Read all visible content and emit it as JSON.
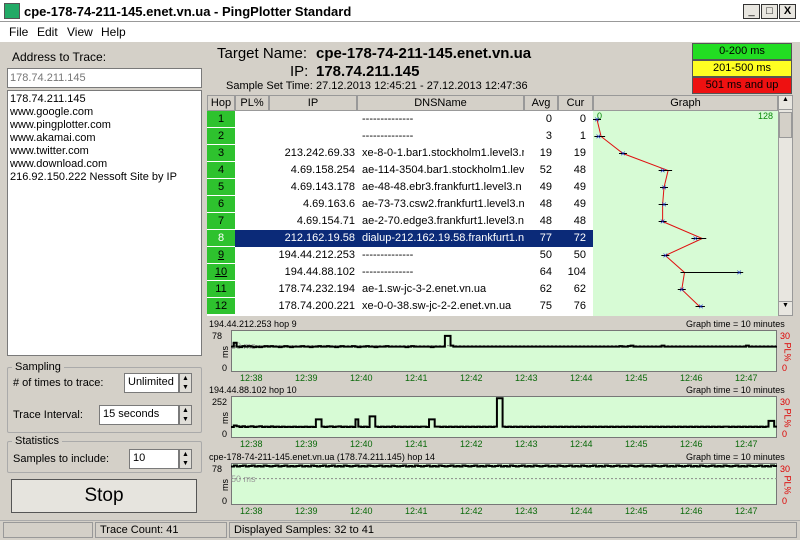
{
  "window": {
    "title": "cpe-178-74-211-145.enet.vn.ua - PingPlotter Standard",
    "min_label": "_",
    "max_label": "□",
    "close_label": "X"
  },
  "menu": [
    "File",
    "Edit",
    "View",
    "Help"
  ],
  "left": {
    "address_label": "Address to Trace:",
    "address_value": "178.74.211.145",
    "history": [
      "178.74.211.145",
      "www.google.com",
      "www.pingplotter.com",
      "www.akamai.com",
      "www.twitter.com",
      "www.download.com",
      "216.92.150.222 Nessoft Site by IP"
    ],
    "sampling_title": "Sampling",
    "times_label": "# of times to trace:",
    "times_value": "Unlimited",
    "interval_label": "Trace Interval:",
    "interval_value": "15 seconds",
    "stats_title": "Statistics",
    "samples_label": "Samples to include:",
    "samples_value": "10",
    "stop_label": "Stop"
  },
  "target": {
    "name_label": "Target Name:",
    "name_value": "cpe-178-74-211-145.enet.vn.ua",
    "ip_label": "IP:",
    "ip_value": "178.74.211.145",
    "time_label": "Sample Set Time:",
    "time_value": "27.12.2013 12:45:21 - 27.12.2013 12:47:36"
  },
  "legend": [
    {
      "label": "0-200 ms",
      "color": "#22dd22"
    },
    {
      "label": "201-500 ms",
      "color": "#ffff22"
    },
    {
      "label": "501 ms and up",
      "color": "#ee1111"
    }
  ],
  "columns": {
    "hop": "Hop",
    "pl": "PL%",
    "ip": "IP",
    "dns": "DNSName",
    "avg": "Avg",
    "cur": "Cur",
    "graph": "Graph"
  },
  "graph_scale": {
    "min": "0",
    "max": "128"
  },
  "hops": [
    {
      "hop": "1",
      "ip": "",
      "dns": "--------------",
      "avg": "0",
      "cur": "0"
    },
    {
      "hop": "2",
      "ip": "",
      "dns": "--------------",
      "avg": "3",
      "cur": "1"
    },
    {
      "hop": "3",
      "ip": "213.242.69.33",
      "dns": "xe-8-0-1.bar1.stockholm1.level3.n",
      "avg": "19",
      "cur": "19"
    },
    {
      "hop": "4",
      "ip": "4.69.158.254",
      "dns": "ae-114-3504.bar1.stockholm1.lev",
      "avg": "52",
      "cur": "48"
    },
    {
      "hop": "5",
      "ip": "4.69.143.178",
      "dns": "ae-48-48.ebr3.frankfurt1.level3.n",
      "avg": "49",
      "cur": "49"
    },
    {
      "hop": "6",
      "ip": "4.69.163.6",
      "dns": "ae-73-73.csw2.frankfurt1.level3.n",
      "avg": "48",
      "cur": "49"
    },
    {
      "hop": "7",
      "ip": "4.69.154.71",
      "dns": "ae-2-70.edge3.frankfurt1.level3.n",
      "avg": "48",
      "cur": "48"
    },
    {
      "hop": "8",
      "ip": "212.162.19.58",
      "dns": "dialup-212.162.19.58.frankfurt1.n",
      "avg": "77",
      "cur": "72"
    },
    {
      "hop": "9",
      "ip": "194.44.212.253",
      "dns": "--------------",
      "avg": "50",
      "cur": "50"
    },
    {
      "hop": "10",
      "ip": "194.44.88.102",
      "dns": "--------------",
      "avg": "64",
      "cur": "104"
    },
    {
      "hop": "11",
      "ip": "178.74.232.194",
      "dns": "ae-1.sw-jc-3-2.enet.vn.ua",
      "avg": "62",
      "cur": "62"
    },
    {
      "hop": "12",
      "ip": "178.74.200.221",
      "dns": "xe-0-0-38.sw-jc-2-2.enet.vn.ua",
      "avg": "75",
      "cur": "76"
    }
  ],
  "chart_data": [
    {
      "type": "line",
      "title": "194.44.212.253 hop 9",
      "graph_time": "Graph time = 10 minutes",
      "ylabel": "ms",
      "y2label": "PL%",
      "y_top": "78",
      "y_mid": "50 ms",
      "y_bottom": "0",
      "pl_top": "30",
      "pl_bottom": "0",
      "x": [
        "12:38",
        "12:39",
        "12:40",
        "12:41",
        "12:42",
        "12:43",
        "12:44",
        "12:45",
        "12:46",
        "12:47"
      ],
      "values": [
        48,
        56,
        48,
        47,
        49,
        48,
        49,
        48,
        47,
        48,
        47,
        48,
        49,
        48,
        49,
        48,
        48,
        47,
        48,
        49,
        48,
        47,
        48,
        48,
        48,
        49,
        48,
        48,
        47,
        48,
        48,
        49,
        48,
        48,
        49,
        48,
        48,
        47,
        48,
        49,
        48,
        48,
        48,
        49,
        48,
        47,
        48,
        48,
        49,
        48,
        48,
        47,
        48,
        48,
        48,
        49,
        48,
        48,
        48,
        48,
        48,
        48,
        47,
        48,
        49,
        48,
        48,
        48,
        48,
        48,
        48,
        47,
        48,
        48,
        48,
        48,
        70,
        70,
        50,
        48,
        48,
        48,
        48,
        48,
        48,
        48,
        48,
        48,
        48,
        48,
        48,
        48,
        48,
        48,
        48,
        48,
        48,
        48,
        48,
        48,
        48,
        48,
        48,
        48,
        48,
        48,
        48,
        48,
        48,
        48,
        48,
        48,
        48,
        48,
        48,
        48,
        48,
        48,
        48,
        48,
        48,
        48,
        48,
        48,
        48,
        48,
        48,
        48,
        48,
        48,
        48,
        48,
        48,
        48,
        48,
        48,
        48,
        48,
        49,
        48,
        48,
        49,
        50,
        48,
        48,
        48,
        48,
        48,
        48,
        48,
        48,
        48,
        48,
        50,
        48,
        48,
        48,
        48,
        48,
        48,
        48,
        48,
        48,
        48,
        48,
        48,
        48,
        48,
        48,
        48,
        48,
        48,
        48,
        48,
        48,
        48,
        48,
        48,
        48,
        48,
        48,
        48,
        48,
        50,
        48,
        48,
        48,
        48,
        48,
        48,
        48,
        48,
        48,
        48
      ]
    },
    {
      "type": "line",
      "title": "194.44.88.102 hop 10",
      "graph_time": "Graph time = 10 minutes",
      "ylabel": "ms",
      "y2label": "PL%",
      "y_top": "252",
      "y_mid": "",
      "y_bottom": "0",
      "pl_top": "30",
      "pl_bottom": "0",
      "x": [
        "12:38",
        "12:39",
        "12:40",
        "12:41",
        "12:42",
        "12:43",
        "12:44",
        "12:45",
        "12:46",
        "12:47"
      ],
      "values": [
        60,
        70,
        65,
        60,
        65,
        60,
        62,
        65,
        60,
        62,
        65,
        60,
        62,
        60,
        64,
        60,
        62,
        60,
        62,
        60,
        61,
        60,
        62,
        60,
        61,
        60,
        62,
        60,
        61,
        60,
        110,
        110,
        62,
        60,
        62,
        64,
        60,
        62,
        64,
        60,
        62,
        60,
        62,
        60,
        110,
        62,
        60,
        62,
        60,
        130,
        130,
        62,
        60,
        62,
        60,
        62,
        60,
        64,
        60,
        62,
        60,
        62,
        60,
        62,
        60,
        62,
        60,
        62,
        62,
        60,
        110,
        110,
        62,
        62,
        60,
        62,
        60,
        62,
        60,
        62,
        60,
        62,
        60,
        62,
        60,
        62,
        60,
        62,
        60,
        62,
        60,
        62,
        60,
        62,
        250,
        250,
        62,
        60,
        62,
        60,
        62,
        60,
        62,
        60,
        62,
        60,
        62,
        60,
        62,
        60,
        62,
        60,
        62,
        60,
        62,
        60,
        62,
        60,
        62,
        60,
        62,
        60,
        62,
        60,
        62,
        60,
        62,
        60,
        62,
        60,
        62,
        60,
        62,
        60,
        62,
        60,
        62,
        60,
        62,
        60,
        62,
        60,
        62,
        60,
        62,
        60,
        62,
        60,
        62,
        60,
        62,
        60,
        62,
        60,
        62,
        60,
        62,
        60,
        62,
        60,
        62,
        60,
        62,
        60,
        62,
        60,
        62,
        60,
        62,
        60,
        62,
        60,
        62,
        60,
        62,
        62,
        60,
        62,
        60,
        62,
        60,
        62,
        60,
        62,
        60,
        62,
        60,
        62,
        60,
        62,
        100,
        100,
        62
      ]
    },
    {
      "type": "line",
      "title": "cpe-178-74-211-145.enet.vn.ua (178.74.211.145) hop 14",
      "graph_time": "Graph time = 10 minutes",
      "ylabel": "ms",
      "y2label": "PL%",
      "y_top": "78",
      "y_mid": "50 ms",
      "y_bottom": "0",
      "pl_top": "30",
      "pl_bottom": "0",
      "x": [
        "12:38",
        "12:39",
        "12:40",
        "12:41",
        "12:42",
        "12:43",
        "12:44",
        "12:45",
        "12:46",
        "12:47"
      ],
      "values": [
        75,
        77,
        75,
        76,
        77,
        75,
        76,
        77,
        75,
        76,
        75,
        77,
        76,
        75,
        76,
        77,
        75,
        76,
        77,
        75,
        76,
        75,
        76,
        77,
        75,
        76,
        75,
        77,
        76,
        75,
        76,
        77,
        75,
        76,
        77,
        75,
        76,
        75,
        77,
        76,
        75,
        76,
        77,
        75,
        76,
        75,
        77,
        76,
        75,
        76,
        77,
        75,
        76,
        75,
        77,
        76,
        75,
        76,
        77,
        75,
        76,
        75,
        77,
        76,
        75,
        76,
        77,
        75,
        76,
        75,
        77,
        76,
        75,
        76,
        77,
        75,
        76,
        75,
        77,
        76,
        75,
        76,
        77,
        75,
        76,
        75,
        77,
        76,
        75,
        76,
        77,
        75,
        76,
        75,
        77,
        76,
        75,
        76,
        77,
        75,
        76,
        75,
        77,
        76,
        75,
        76,
        77,
        75,
        76,
        75,
        77,
        76,
        75,
        76,
        77,
        75,
        76,
        75,
        77,
        76,
        75,
        76,
        77,
        75,
        76,
        75,
        77,
        76,
        75,
        76,
        77,
        75,
        76,
        75,
        77,
        76,
        75,
        76,
        77,
        75,
        76,
        75,
        77,
        76,
        75,
        76,
        77,
        75,
        76,
        75,
        77,
        76,
        75,
        76,
        77,
        75,
        76,
        75,
        77,
        76,
        75,
        76,
        77,
        75,
        76,
        75,
        77,
        76,
        75,
        76,
        77,
        75,
        76,
        75,
        77,
        76,
        75,
        76,
        77,
        75,
        76,
        75,
        77,
        76
      ]
    }
  ],
  "status": {
    "left": "",
    "trace_count": "Trace Count: 41",
    "displayed": "Displayed Samples: 32 to 41"
  }
}
